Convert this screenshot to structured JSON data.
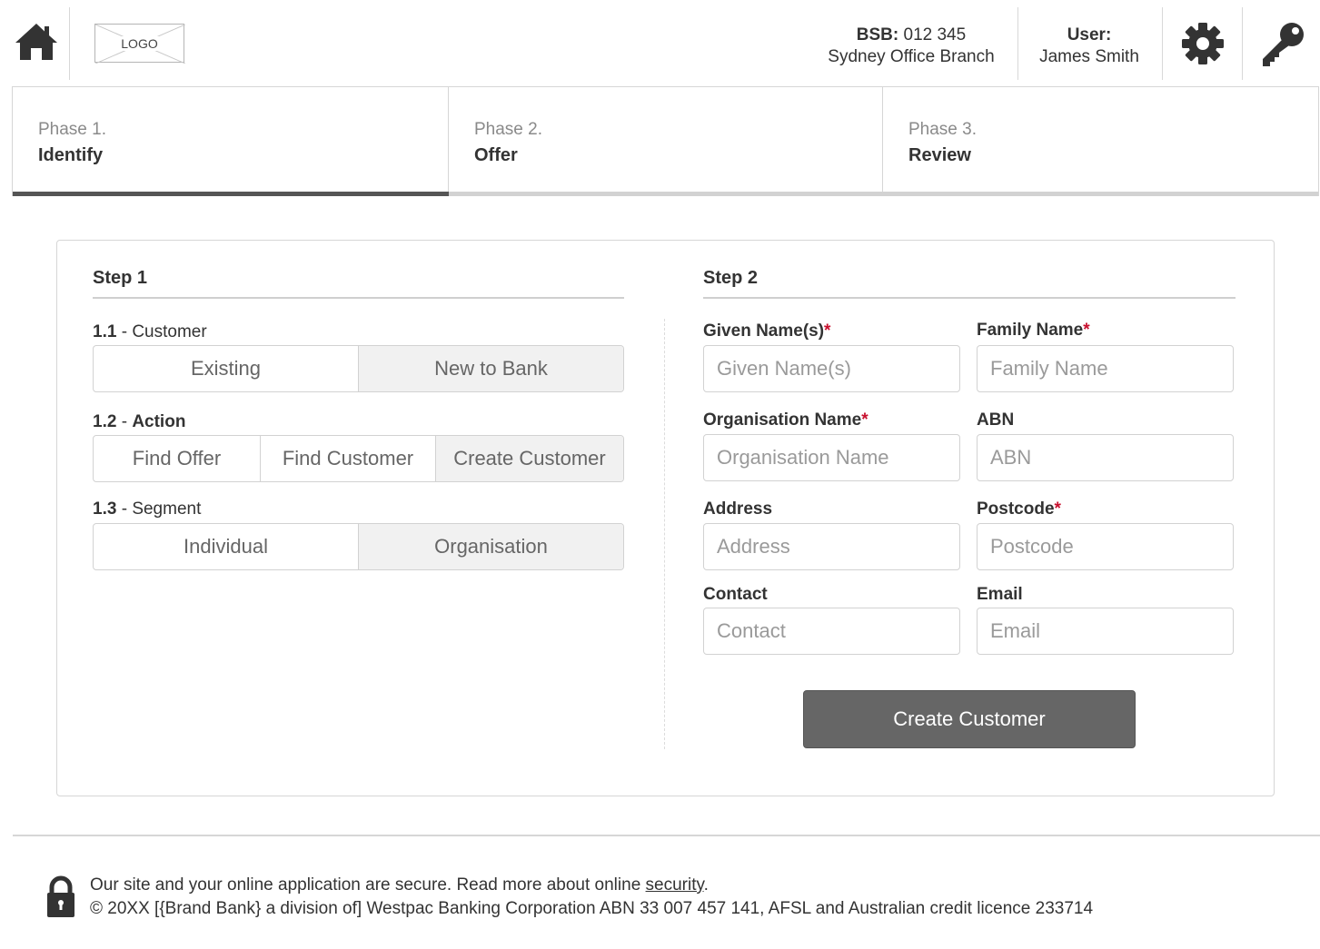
{
  "header": {
    "logo_text": "LOGO",
    "bsb_label": "BSB:",
    "bsb_value": "012 345",
    "branch": "Sydney Office Branch",
    "user_label": "User:",
    "user_name": "James Smith"
  },
  "phases": [
    {
      "number": "Phase 1.",
      "title": "Identify",
      "active": true
    },
    {
      "number": "Phase 2.",
      "title": "Offer",
      "active": false
    },
    {
      "number": "Phase 3.",
      "title": "Review",
      "active": false
    }
  ],
  "step1": {
    "title": "Step 1",
    "customer": {
      "num": "1.1",
      "name": "Customer",
      "options": [
        "Existing",
        "New to Bank"
      ],
      "selected": "New to Bank"
    },
    "action": {
      "num": "1.2",
      "name": "Action",
      "options": [
        "Find Offer",
        "Find Customer",
        "Create Customer"
      ],
      "selected": "Create Customer"
    },
    "segment": {
      "num": "1.3",
      "name": "Segment",
      "options": [
        "Individual",
        "Organisation"
      ],
      "selected": "Organisation"
    }
  },
  "step2": {
    "title": "Step 2",
    "fields": {
      "given_name": {
        "label": "Given Name(s)",
        "required": "*",
        "placeholder": "Given Name(s)",
        "value": ""
      },
      "family_name": {
        "label": "Family Name",
        "required": "*",
        "placeholder": "Family Name",
        "value": ""
      },
      "organisation_name": {
        "label": "Organisation Name",
        "required": "*",
        "placeholder": "Organisation Name",
        "value": ""
      },
      "abn": {
        "label": "ABN",
        "required": "",
        "placeholder": "ABN",
        "value": ""
      },
      "address": {
        "label": "Address",
        "required": "",
        "placeholder": "Address",
        "value": ""
      },
      "postcode": {
        "label": "Postcode",
        "required": "*",
        "placeholder": "Postcode",
        "value": ""
      },
      "contact": {
        "label": "Contact",
        "required": "",
        "placeholder": "Contact",
        "value": ""
      },
      "email": {
        "label": "Email",
        "required": "",
        "placeholder": "Email",
        "value": ""
      }
    },
    "submit_label": "Create Customer"
  },
  "footer": {
    "secure_text": "Our site and your online application are secure. Read more about online ",
    "security_link": "security",
    "period": ".",
    "copyright": "© 20XX [{Brand Bank} a division of] Westpac Banking Corporation ABN 33 007 457 141, AFSL and Australian credit licence 233714"
  },
  "colors": {
    "active_phase_bar": "#555555",
    "inactive_phase_bar": "#d2d2d2",
    "required_asterisk": "#c8102e",
    "primary_button": "#666666",
    "icon": "#333333"
  },
  "icons": [
    "home-icon",
    "gear-icon",
    "key-icon",
    "lock-icon"
  ]
}
